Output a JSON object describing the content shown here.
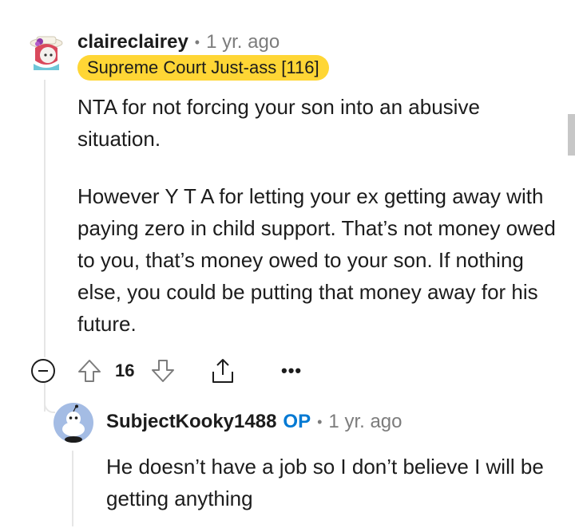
{
  "comment": {
    "username": "claireclairey",
    "separator": "•",
    "time": "1 yr. ago",
    "flair": "Supreme Court Just-ass [116]",
    "paragraphs": [
      "NTA for not forcing your son into an abusive situation.",
      "However Y T A for letting your ex getting away with paying zero in child support. That’s not money owed to you, that’s money owed to your son. If nothing else, you could be putting that money away for his future."
    ],
    "score": "16",
    "more": "•••",
    "icons": {
      "avatar": "user-avatar-icon",
      "collapse": "collapse-icon",
      "upvote": "upvote-arrow-icon",
      "downvote": "downvote-arrow-icon",
      "share": "share-icon",
      "more": "more-options-icon"
    },
    "colors": {
      "flair_bg": "#ffd635",
      "meta": "#7c7c7c"
    }
  },
  "reply": {
    "username": "SubjectKooky1488",
    "op_badge": "OP",
    "separator": "•",
    "time": "1 yr. ago",
    "text": "He doesn’t have a job so I don’t believe I will be getting anything",
    "colors": {
      "op": "#0079d3",
      "avatar_bg": "#a4bce4"
    }
  }
}
